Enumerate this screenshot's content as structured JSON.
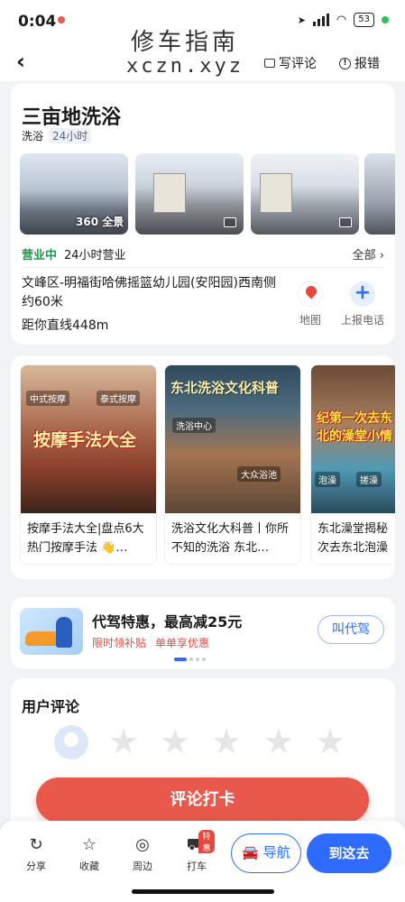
{
  "status_bar": {
    "time": "0:04",
    "battery": "53"
  },
  "watermark": {
    "cn": "修车指南",
    "en": "xczn.xyz"
  },
  "nav": {
    "write_review": "写评论",
    "report": "报错"
  },
  "poi": {
    "title": "三亩地洗浴",
    "tags": [
      "洗浴",
      "24小时"
    ],
    "pano_label": "360 全景",
    "open_status": "营业中",
    "open_hours": "24小时营业",
    "all_link": "全部 ›",
    "address": "文峰区-明福街哈佛摇篮幼儿园(安阳园)西南侧约60米",
    "distance": "距你直线448m",
    "map_label": "地图",
    "report_phone_label": "上报电话"
  },
  "articles": [
    {
      "overlay": "按摩手法大全",
      "sub1": "中式按摩",
      "sub2": "泰式按摩",
      "text": "按摩手法大全|盘点6大热门按摩手法 👋…"
    },
    {
      "overlay": "东北洗浴文化科普",
      "sub1": "洗浴中心",
      "sub2": "大众浴池",
      "text": "洗浴文化大科普丨你所不知的洗浴 东北…"
    },
    {
      "overlay": "纪第一次去东北的澡堂小情",
      "sub1": "泡澡",
      "sub2": "搓澡",
      "text": "东北澡堂揭秘次去东北泡澡"
    }
  ],
  "promo": {
    "title": "代驾特惠，最高减25元",
    "tag1": "限时领补贴",
    "tag2": "单单享优惠",
    "button": "叫代驾"
  },
  "review": {
    "title": "用户评论",
    "cta": "评论打卡"
  },
  "bottom_bar": {
    "tabs": [
      {
        "label": "分享",
        "icon": "share-icon"
      },
      {
        "label": "收藏",
        "icon": "star-icon"
      },
      {
        "label": "周边",
        "icon": "compass-icon"
      },
      {
        "label": "打车",
        "icon": "taxi-icon"
      }
    ],
    "taxi_badge": "特惠",
    "navigate": "导航",
    "go_here": "到这去"
  },
  "colors": {
    "accent_blue": "#2f6bff",
    "cta_red": "#e9594b",
    "open_green": "#1a9b4b"
  }
}
